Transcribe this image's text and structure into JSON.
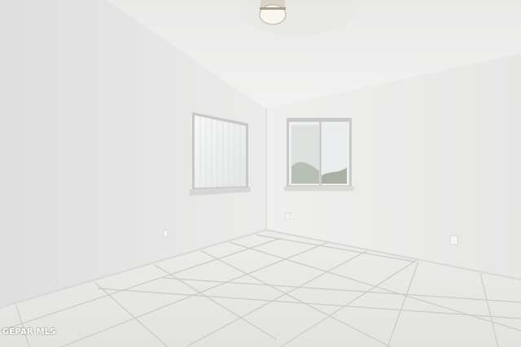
{
  "photo": {
    "subject": "empty-room",
    "watermark": "GEPAR MLS"
  },
  "colors": {
    "wall_left": "#e4e4e4",
    "wall_back": "#ececeb",
    "ceiling": "#efefee",
    "floor_tile": "#e8e8e6",
    "grout": "#c9c9c6"
  }
}
